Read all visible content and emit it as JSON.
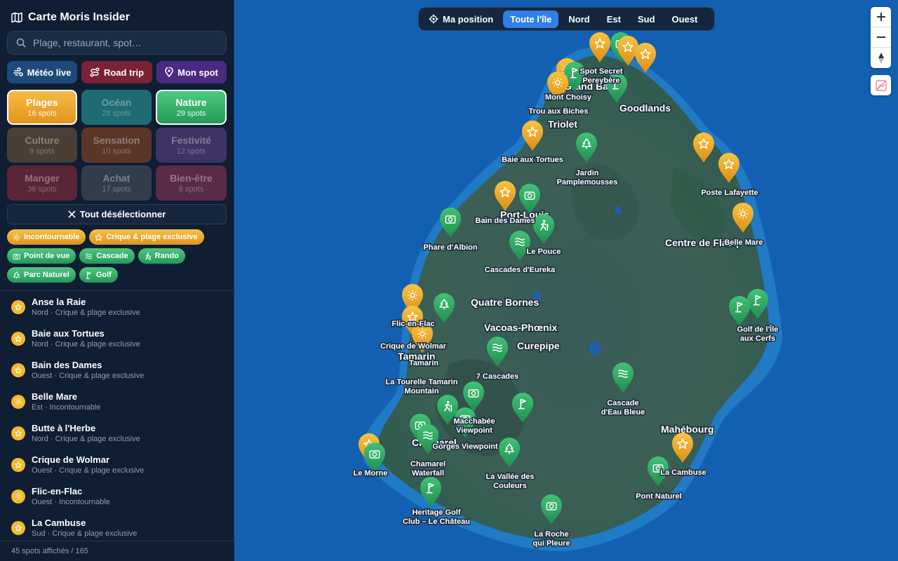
{
  "sidebar": {
    "title": "Carte Moris Insider",
    "search_placeholder": "Plage, restaurant, spot…",
    "actions": [
      {
        "label": "Météo live",
        "icon": "weather-icon"
      },
      {
        "label": "Road trip",
        "icon": "route-icon"
      },
      {
        "label": "Mon spot",
        "icon": "pin-icon"
      }
    ],
    "categories": [
      {
        "name": "Plages",
        "count": "16 spots",
        "active": true,
        "color": "#f0a526"
      },
      {
        "name": "Océan",
        "count": "28 spots",
        "active": false,
        "color": "#1f6b73"
      },
      {
        "name": "Nature",
        "count": "29 spots",
        "active": true,
        "color": "#2ea25f"
      },
      {
        "name": "Culture",
        "count": "9 spots",
        "active": false,
        "color": "#5a4a3a"
      },
      {
        "name": "Sensation",
        "count": "10 spots",
        "active": false,
        "color": "#6b3f2c"
      },
      {
        "name": "Festivité",
        "count": "12 spots",
        "active": false,
        "color": "#4e3a78"
      },
      {
        "name": "Manger",
        "count": "36 spots",
        "active": false,
        "color": "#6b2a3b"
      },
      {
        "name": "Achat",
        "count": "17 spots",
        "active": false,
        "color": "#3b4656"
      },
      {
        "name": "Bien-être",
        "count": "8 spots",
        "active": false,
        "color": "#6b3050"
      }
    ],
    "deselect_label": "Tout désélectionner",
    "filters": [
      {
        "label": "Incontournable",
        "kind": "gold",
        "icon": "sun-icon"
      },
      {
        "label": "Crique & plage exclusive",
        "kind": "gold",
        "icon": "star-icon"
      },
      {
        "label": "Point de vue",
        "kind": "green",
        "icon": "camera-icon"
      },
      {
        "label": "Cascade",
        "kind": "green",
        "icon": "waves-icon"
      },
      {
        "label": "Rando",
        "kind": "green",
        "icon": "hiker-icon"
      },
      {
        "label": "Parc Naturel",
        "kind": "green",
        "icon": "tree-icon"
      },
      {
        "label": "Golf",
        "kind": "green",
        "icon": "golf-icon"
      }
    ],
    "spots": [
      {
        "name": "Anse la Raie",
        "meta": "Nord · Crique & plage exclusive"
      },
      {
        "name": "Baie aux Tortues",
        "meta": "Nord · Crique & plage exclusive"
      },
      {
        "name": "Bain des Dames",
        "meta": "Ouest · Crique & plage exclusive"
      },
      {
        "name": "Belle Mare",
        "meta": "Est · Incontournable"
      },
      {
        "name": "Butte à l'Herbe",
        "meta": "Nord · Crique & plage exclusive"
      },
      {
        "name": "Crique de Wolmar",
        "meta": "Ouest · Crique & plage exclusive"
      },
      {
        "name": "Flic-en-Flac",
        "meta": "Ouest · Incontournable"
      },
      {
        "name": "La Cambuse",
        "meta": "Sud · Crique & plage exclusive"
      }
    ],
    "footer": "45 spots affichés / 165"
  },
  "map": {
    "regions": [
      {
        "label": "Ma position",
        "icon": "locate-icon",
        "active": false
      },
      {
        "label": "Toute l'île",
        "active": true
      },
      {
        "label": "Nord",
        "active": false
      },
      {
        "label": "Est",
        "active": false
      },
      {
        "label": "Sud",
        "active": false
      },
      {
        "label": "Ouest",
        "active": false
      }
    ],
    "towns": [
      "Grand Baie",
      "Goodlands",
      "Triolet",
      "Port-Louis",
      "Centre de Flacq",
      "Quatre Bornes",
      "Vacoas-Phœnix",
      "Curepipe",
      "Tamarin",
      "Chamarel",
      "Mahébourg"
    ],
    "markers": [
      {
        "kind": "star",
        "color": "gold",
        "label": "Baie aux Tortues"
      },
      {
        "kind": "tree",
        "color": "green",
        "label": "Jardin Pamplemousses"
      },
      {
        "kind": "star",
        "color": "gold",
        "label": "Poste Lafayette"
      },
      {
        "kind": "sun",
        "color": "gold",
        "label": "Belle Mare"
      },
      {
        "kind": "golf",
        "color": "green",
        "label": "Golf de l'Île aux Cerfs"
      },
      {
        "kind": "waves",
        "color": "green",
        "label": "Cascade d'Eau Bleue"
      },
      {
        "kind": "star",
        "color": "gold",
        "label": "La Cambuse"
      },
      {
        "kind": "camera",
        "color": "green",
        "label": "Pont Naturel"
      },
      {
        "kind": "camera",
        "color": "green",
        "label": "La Roche qui Pleure"
      },
      {
        "kind": "tree",
        "color": "green",
        "label": "La Vallée des Couleurs"
      },
      {
        "kind": "golf",
        "color": "green",
        "label": "Heritage Golf Club – Le Château"
      },
      {
        "kind": "waves",
        "color": "green",
        "label": "Chamarel Waterfall"
      },
      {
        "kind": "camera",
        "color": "green",
        "label": "Le Morne"
      },
      {
        "kind": "camera",
        "color": "green",
        "label": "Macchabée Viewpoint"
      },
      {
        "kind": "camera",
        "color": "green",
        "label": "Gorges Viewpoint"
      },
      {
        "kind": "waves",
        "color": "green",
        "label": "7 Cascades"
      },
      {
        "kind": "hiker",
        "color": "green",
        "label": "La Tourelle Tamarin Mountain"
      },
      {
        "kind": "sun",
        "color": "gold",
        "label": "Flic-en-Flac"
      },
      {
        "kind": "star",
        "color": "gold",
        "label": "Crique de Wolmar"
      },
      {
        "kind": "camera",
        "color": "green",
        "label": "Phare d'Albion"
      },
      {
        "kind": "waves",
        "color": "green",
        "label": "Cascades d'Eureka"
      },
      {
        "kind": "hiker",
        "color": "green",
        "label": "Le Pouce"
      },
      {
        "kind": "star",
        "color": "gold",
        "label": "Bain des Dames"
      },
      {
        "kind": "sun",
        "color": "gold",
        "label": "Mont Choisy"
      },
      {
        "kind": "golf",
        "color": "green",
        "label": "Spot Secret Pereybère"
      },
      {
        "kind": "star",
        "color": "gold",
        "label": "Trou aux Biches"
      }
    ],
    "controls": {
      "zoom_in": "+",
      "zoom_out": "−"
    }
  }
}
